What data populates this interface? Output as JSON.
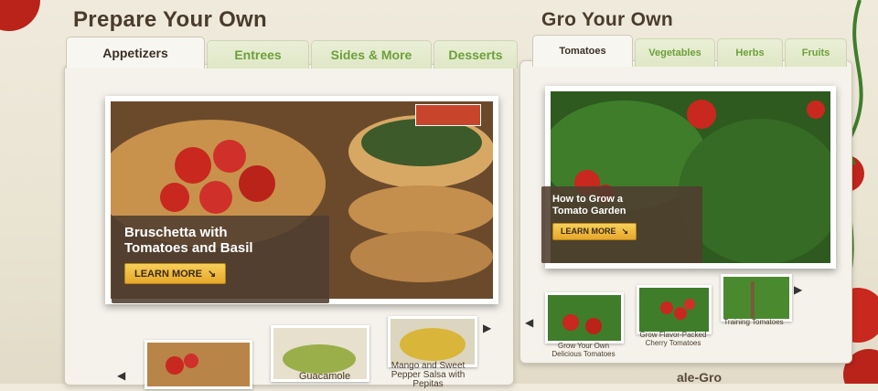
{
  "prepare": {
    "title": "Prepare Your Own",
    "tabs": [
      "Appetizers",
      "Entrees",
      "Sides & More",
      "Desserts"
    ],
    "feature": {
      "title_line1": "Bruschetta with",
      "title_line2": "Tomatoes and Basil",
      "button": "LEARN MORE"
    },
    "thumbs": [
      {
        "label": ""
      },
      {
        "label": "Guacamole"
      },
      {
        "label_line1": "Mango and Sweet",
        "label_line2": "Pepper Salsa with",
        "label_line3": "Pepitas"
      }
    ]
  },
  "gro": {
    "title": "Gro Your Own",
    "tabs": [
      "Tomatoes",
      "Vegetables",
      "Herbs",
      "Fruits"
    ],
    "feature": {
      "title_line1": "How to Grow a",
      "title_line2": "Tomato Garden",
      "button": "LEARN MORE"
    },
    "thumbs": [
      {
        "label_line1": "Grow Your Own",
        "label_line2": "Delicious Tomatoes"
      },
      {
        "label_line1": "Grow Flavor-Packed",
        "label_line2": "Cherry Tomatoes"
      },
      {
        "label_line1": "Training Tomatoes"
      }
    ]
  },
  "footer": {
    "brand_fragment": "ale-Gro"
  },
  "colors": {
    "tab_green": "#6da03a",
    "caption_bg": "#503e30",
    "button_gold": "#f0bb3f",
    "tomato_red": "#c8281e"
  }
}
